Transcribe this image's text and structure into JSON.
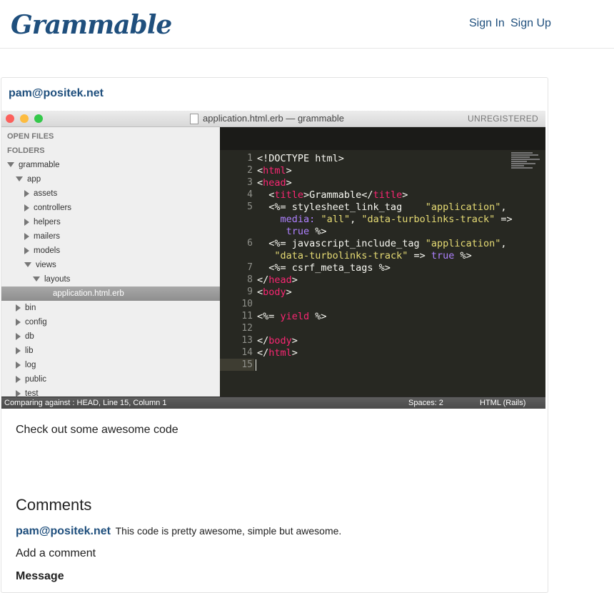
{
  "nav": {
    "brand": "Grammable",
    "sign_in": "Sign In",
    "sign_up": "Sign Up"
  },
  "post": {
    "user": "pam@positek.net",
    "caption": "Check out some awesome code",
    "image": {
      "window_title": "application.html.erb — grammable",
      "registration": "UNREGISTERED",
      "sidebar": {
        "open_files": "OPEN FILES",
        "folders": "FOLDERS",
        "tree": [
          {
            "label": "grammable",
            "arrow": "down"
          },
          {
            "label": "app",
            "arrow": "down"
          },
          {
            "label": "assets",
            "arrow": "right"
          },
          {
            "label": "controllers",
            "arrow": "right"
          },
          {
            "label": "helpers",
            "arrow": "right"
          },
          {
            "label": "mailers",
            "arrow": "right"
          },
          {
            "label": "models",
            "arrow": "right"
          },
          {
            "label": "views",
            "arrow": "down"
          },
          {
            "label": "layouts",
            "arrow": "down"
          },
          {
            "label": "application.html.erb",
            "arrow": "none"
          },
          {
            "label": "bin",
            "arrow": "right"
          },
          {
            "label": "config",
            "arrow": "right"
          },
          {
            "label": "db",
            "arrow": "right"
          },
          {
            "label": "lib",
            "arrow": "right"
          },
          {
            "label": "log",
            "arrow": "right"
          },
          {
            "label": "public",
            "arrow": "right"
          },
          {
            "label": "test",
            "arrow": "right"
          }
        ]
      },
      "code_lines": [
        {
          "n": "1",
          "html": "<!DOCTYPE html>"
        },
        {
          "n": "2",
          "html": "<html>"
        },
        {
          "n": "3",
          "html": "<head>"
        },
        {
          "n": "4",
          "html": "  <title>Grammable</title>"
        },
        {
          "n": "5",
          "html": "  <%= stylesheet_link_tag    \"application\","
        },
        {
          "n": "",
          "html": "    media: \"all\", \"data-turbolinks-track\" =>"
        },
        {
          "n": "",
          "html": "     true %>"
        },
        {
          "n": "6",
          "html": "  <%= javascript_include_tag \"application\","
        },
        {
          "n": "",
          "html": "   \"data-turbolinks-track\" => true %>"
        },
        {
          "n": "7",
          "html": "  <%= csrf_meta_tags %>"
        },
        {
          "n": "8",
          "html": "</head>"
        },
        {
          "n": "9",
          "html": "<body>"
        },
        {
          "n": "10",
          "html": ""
        },
        {
          "n": "11",
          "html": "<%= yield %>"
        },
        {
          "n": "12",
          "html": ""
        },
        {
          "n": "13",
          "html": "</body>"
        },
        {
          "n": "14",
          "html": "</html>"
        },
        {
          "n": "15",
          "html": ""
        }
      ],
      "status_left": "Comparing against : HEAD, Line 15, Column 1",
      "status_spaces": "Spaces: 2",
      "status_syntax": "HTML (Rails)"
    }
  },
  "comments": {
    "heading": "Comments",
    "items": [
      {
        "user": "pam@positek.net",
        "text": "This code is pretty awesome, simple but awesome."
      }
    ],
    "add_label": "Add a comment",
    "message_label": "Message"
  }
}
